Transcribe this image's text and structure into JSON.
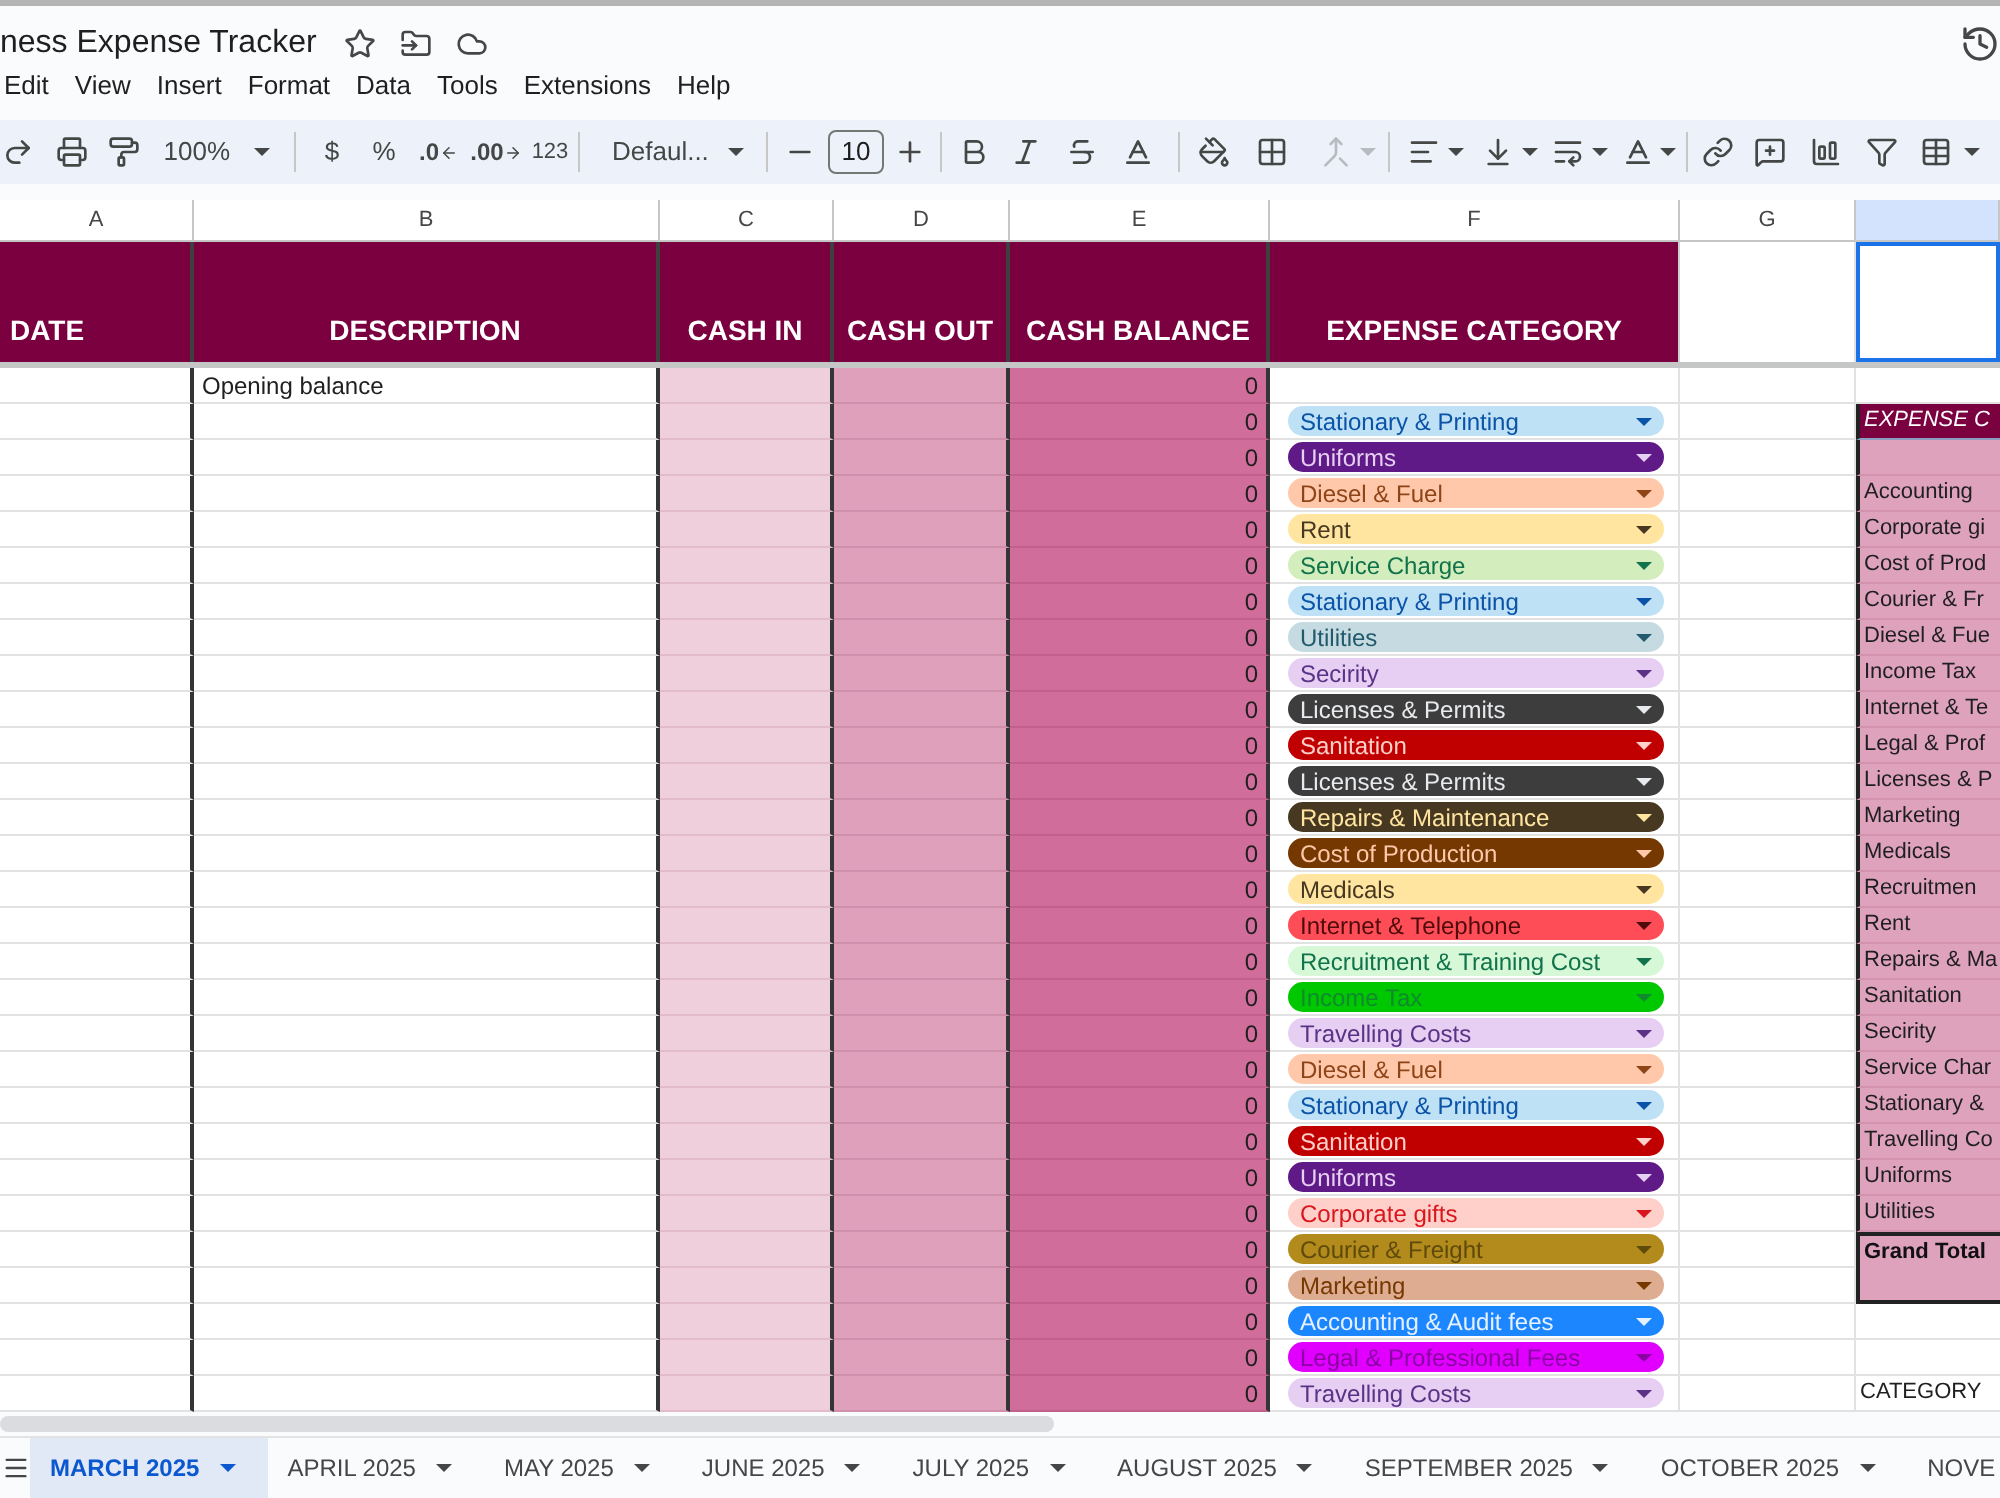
{
  "document": {
    "title": "ness Expense Tracker"
  },
  "menu": [
    "Edit",
    "View",
    "Insert",
    "Format",
    "Data",
    "Tools",
    "Extensions",
    "Help"
  ],
  "toolbar": {
    "zoom": "100%",
    "currency": "$",
    "percent": "%",
    "decrease_decimals": ".0",
    "increase_decimals": ".00",
    "more_formats": "123",
    "font": "Defaul...",
    "font_size": "10",
    "merge_disabled": true
  },
  "columns": [
    {
      "letter": "A",
      "header": "DATE",
      "selected": false
    },
    {
      "letter": "B",
      "header": "DESCRIPTION",
      "selected": false
    },
    {
      "letter": "C",
      "header": "CASH IN",
      "selected": false
    },
    {
      "letter": "D",
      "header": "CASH OUT",
      "selected": false
    },
    {
      "letter": "E",
      "header": "CASH BALANCE",
      "selected": false
    },
    {
      "letter": "F",
      "header": "EXPENSE CATEGORY",
      "selected": false
    },
    {
      "letter": "G",
      "selected": false
    },
    {
      "selected": true
    }
  ],
  "rows": [
    {
      "description": "Opening balance",
      "cash_balance": "0"
    },
    {
      "cash_balance": "0",
      "category": {
        "label": "Stationary & Printing",
        "color": "#bfe1f6"
      }
    },
    {
      "cash_balance": "0",
      "category": {
        "label": "Uniforms",
        "color": "#5f1a88"
      }
    },
    {
      "cash_balance": "0",
      "category": {
        "label": "Diesel & Fuel",
        "color": "#ffc8aa"
      }
    },
    {
      "cash_balance": "0",
      "category": {
        "label": "Rent",
        "color": "#ffe5a0"
      }
    },
    {
      "cash_balance": "0",
      "category": {
        "label": "Service Charge",
        "color": "#d4edbc"
      }
    },
    {
      "cash_balance": "0",
      "category": {
        "label": "Stationary & Printing",
        "color": "#bfe1f6"
      }
    },
    {
      "cash_balance": "0",
      "category": {
        "label": "Utilities",
        "color": "#c6dbe1"
      }
    },
    {
      "cash_balance": "0",
      "category": {
        "label": "Secirity",
        "color": "#e6cff2"
      }
    },
    {
      "cash_balance": "0",
      "category": {
        "label": "Licenses & Permits",
        "color": "#3d3d3d"
      }
    },
    {
      "cash_balance": "0",
      "category": {
        "label": "Sanitation",
        "color": "#c00000"
      }
    },
    {
      "cash_balance": "0",
      "category": {
        "label": "Licenses & Permits",
        "color": "#3d3d3d"
      }
    },
    {
      "cash_balance": "0",
      "category": {
        "label": "Repairs & Maintenance",
        "color": "#473821"
      }
    },
    {
      "cash_balance": "0",
      "category": {
        "label": "Cost of Production",
        "color": "#753800"
      }
    },
    {
      "cash_balance": "0",
      "category": {
        "label": "Medicals",
        "color": "#ffe5a0"
      }
    },
    {
      "cash_balance": "0",
      "category": {
        "label": "Internet & Telephone",
        "color": "#ff4d57"
      }
    },
    {
      "cash_balance": "0",
      "category": {
        "label": "Recruitment & Training Cost",
        "color": "#d6f8d6"
      }
    },
    {
      "cash_balance": "0",
      "category": {
        "label": "Income Tax",
        "color": "#00c800"
      }
    },
    {
      "cash_balance": "0",
      "category": {
        "label": "Travelling Costs",
        "color": "#e6cff2"
      }
    },
    {
      "cash_balance": "0",
      "category": {
        "label": "Diesel & Fuel",
        "color": "#ffc8aa"
      }
    },
    {
      "cash_balance": "0",
      "category": {
        "label": "Stationary & Printing",
        "color": "#bfe1f6"
      }
    },
    {
      "cash_balance": "0",
      "category": {
        "label": "Sanitation",
        "color": "#c00000"
      }
    },
    {
      "cash_balance": "0",
      "category": {
        "label": "Uniforms",
        "color": "#5f1a88"
      }
    },
    {
      "cash_balance": "0",
      "category": {
        "label": "Corporate gifts",
        "color": "#ffcfc9"
      }
    },
    {
      "cash_balance": "0",
      "category": {
        "label": "Courier & Freight",
        "color": "#b38b1d"
      }
    },
    {
      "cash_balance": "0",
      "category": {
        "label": "Marketing",
        "color": "#deac91"
      }
    },
    {
      "cash_balance": "0",
      "category": {
        "label": "Accounting & Audit fees",
        "color": "#1c86ff"
      }
    },
    {
      "cash_balance": "0",
      "category": {
        "label": "Legal & Professional Fees",
        "color": "#e100ff"
      }
    },
    {
      "cash_balance": "0",
      "category": {
        "label": "Travelling Costs",
        "color": "#e6cff2"
      }
    }
  ],
  "summary_table": {
    "title": "EXPENSE C",
    "items": [
      "Accounting",
      "Corporate gi",
      "Cost of Prod",
      "Courier & Fr",
      "Diesel & Fue",
      "Income Tax",
      "Internet & Te",
      "Legal & Prof",
      "Licenses & P",
      "Marketing",
      "Medicals",
      "Recruitmen",
      "Rent",
      "Repairs & Ma",
      "Sanitation",
      "Secirity",
      "Service Char",
      "Stationary &",
      "Travelling Co",
      "Uniforms",
      "Utilities"
    ],
    "total_label": "Grand Total",
    "note": "CATEGORY"
  },
  "sheet_tabs": [
    {
      "label": "MARCH 2025",
      "selected": true
    },
    {
      "label": "APRIL 2025",
      "selected": false
    },
    {
      "label": "MAY 2025",
      "selected": false
    },
    {
      "label": "JUNE 2025",
      "selected": false
    },
    {
      "label": "JULY 2025",
      "selected": false
    },
    {
      "label": "AUGUST 2025",
      "selected": false
    },
    {
      "label": "SEPTEMBER 2025",
      "selected": false
    },
    {
      "label": "OCTOBER 2025",
      "selected": false
    },
    {
      "label": "NOVE",
      "selected": false
    }
  ]
}
